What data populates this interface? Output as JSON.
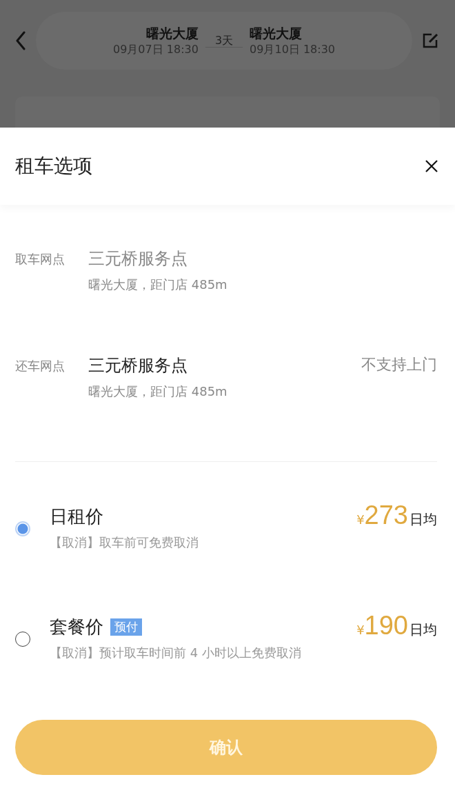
{
  "background": {
    "trip": {
      "from_place": "曙光大厦",
      "from_time": "09月07日 18:30",
      "duration": "3天",
      "to_place": "曙光大厦",
      "to_time": "09月10日 18:30"
    }
  },
  "sheet": {
    "title": "租车选项",
    "locations": [
      {
        "label": "取车网点",
        "name": "三元桥服务点",
        "address": "曙光大厦，距门店 485m",
        "dimmed": true
      },
      {
        "label": "还车网点",
        "name": "三元桥服务点",
        "address": "曙光大厦，距门店 485m",
        "dimmed": false,
        "note": "不支持上门"
      }
    ],
    "prices": [
      {
        "name": "日租价",
        "selected": true,
        "policy": "【取消】取车前可免费取消",
        "currency": "¥",
        "amount": "273",
        "unit": "日均"
      },
      {
        "name": "套餐价",
        "selected": false,
        "tag": "预付",
        "policy": "【取消】预计取车时间前 4 小时以上免费取消",
        "currency": "¥",
        "amount": "190",
        "unit": "日均"
      }
    ],
    "confirm": "确认"
  }
}
